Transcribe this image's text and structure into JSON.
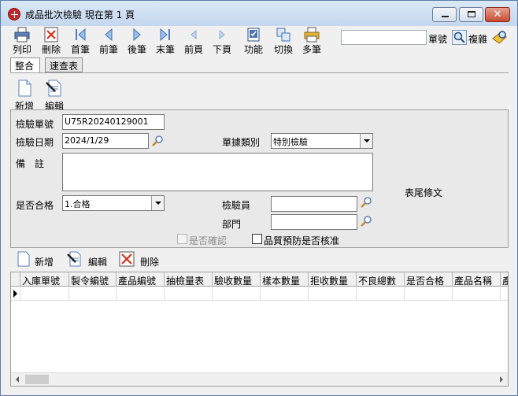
{
  "window": {
    "title": "成品批次檢驗 現在第 1 頁"
  },
  "toolbar": {
    "print": "列印",
    "delete": "刪除",
    "first": "首筆",
    "prev": "前筆",
    "next": "後筆",
    "last": "末筆",
    "prev_page": "前頁",
    "next_page": "下頁",
    "functions": "功能",
    "switch": "切換",
    "multi": "多筆",
    "search_value": "",
    "search_label": "單號",
    "copy_label": "複雜"
  },
  "tabs": [
    {
      "label": "整合",
      "active": true
    },
    {
      "label": "速查表",
      "active": false
    }
  ],
  "header_actions": {
    "add": "新增",
    "edit": "編輯"
  },
  "form": {
    "inspection_no_label": "檢驗單號",
    "inspection_no_value": "U75R20240129001",
    "inspection_date_label": "檢驗日期",
    "inspection_date_value": "2024/1/29",
    "doc_type_label": "單據類別",
    "doc_type_value": "特別檢驗",
    "remark_label": "備　註",
    "remark_value": "",
    "footer_text": "表尾條文",
    "qualified_label": "是否合格",
    "qualified_value": "1.合格",
    "inspector_label": "檢驗員",
    "inspector_value": "",
    "department_label": "部門",
    "department_value": "",
    "confirmed_label": "是否確認",
    "qa_label": "品質預防是否核准"
  },
  "detail_actions": {
    "add": "新增",
    "edit": "編輯",
    "delete": "刪除"
  },
  "grid": {
    "columns": [
      "入庫單號",
      "製令編號",
      "產品編號",
      "抽檢量表",
      "驗收數量",
      "樣本數量",
      "拒收數量",
      "不良總數",
      "是否合格",
      "產品名稱",
      "產"
    ]
  }
}
